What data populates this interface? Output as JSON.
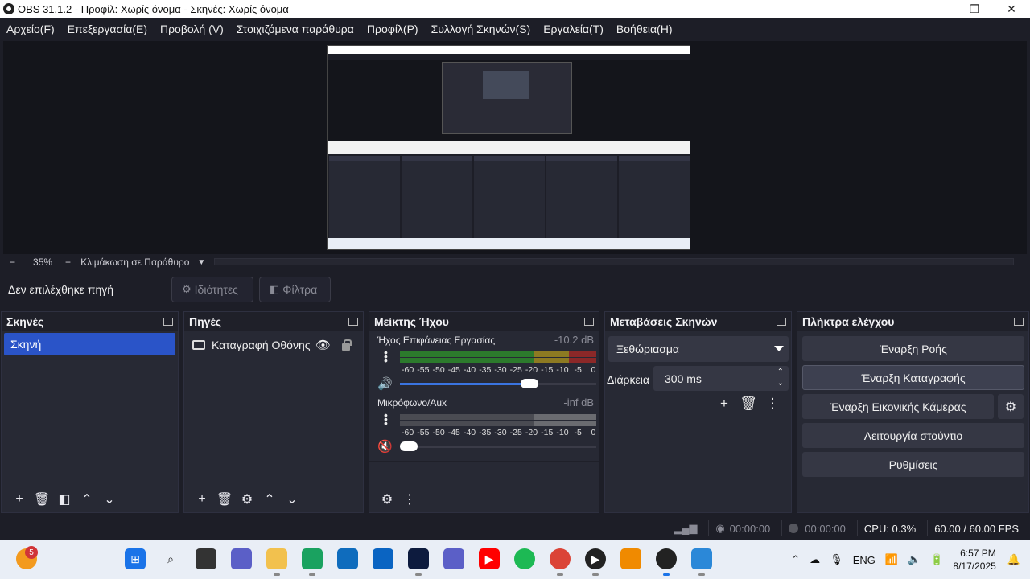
{
  "window": {
    "title": "OBS 31.1.2 - Προφίλ: Χωρίς όνομα - Σκηνές: Χωρίς όνομα",
    "minimize": "—",
    "maximize": "❐",
    "close": "✕"
  },
  "menu": [
    "Αρχείο(F)",
    "Επεξεργασία(E)",
    "Προβολή (V)",
    "Στοιχιζόμενα παράθυρα",
    "Προφίλ(P)",
    "Συλλογή Σκηνών(S)",
    "Εργαλεία(T)",
    "Βοήθεια(H)"
  ],
  "zoom": {
    "minus": "−",
    "value": "35%",
    "plus": "+",
    "mode": "Κλιμάκωση σε Παράθυρο"
  },
  "source_toolbar": {
    "no_source": "Δεν επιλέχθηκε πηγή",
    "properties": "Ιδιότητες",
    "filters": "Φίλτρα"
  },
  "scenes": {
    "title": "Σκηνές",
    "items": [
      "Σκηνή"
    ]
  },
  "sources": {
    "title": "Πηγές",
    "items": [
      "Καταγραφή Οθόνης"
    ]
  },
  "mixer": {
    "title": "Μείκτης Ήχου",
    "channels": [
      {
        "name": "Ήχος Επιφάνειας Εργασίας",
        "db": "-10.2 dB",
        "volume": 0.66,
        "muted": false
      },
      {
        "name": "Μικρόφωνο/Aux",
        "db": "-inf dB",
        "volume": 0.0,
        "muted": true
      }
    ],
    "ticks": [
      "-60",
      "-55",
      "-50",
      "-45",
      "-40",
      "-35",
      "-30",
      "-25",
      "-20",
      "-15",
      "-10",
      "-5",
      "0"
    ]
  },
  "transitions": {
    "title": "Μεταβάσεις Σκηνών",
    "selected": "Ξεθώριασμα",
    "duration_label": "Διάρκεια",
    "duration_value": "300 ms"
  },
  "controls": {
    "title": "Πλήκτρα ελέγχου",
    "start_stream": "Έναρξη Ροής",
    "start_recording": "Έναρξη Καταγραφής",
    "start_virtualcam": "Έναρξη Εικονικής Κάμερας",
    "studio_mode": "Λειτουργία στούντιο",
    "settings": "Ρυθμίσεις"
  },
  "status": {
    "stream_time": "00:00:00",
    "record_time": "00:00:00",
    "cpu": "CPU: 0.3%",
    "fps": "60.00 / 60.00 FPS"
  },
  "taskbar": {
    "badge": "5",
    "lang": "ENG",
    "time": "6:57 PM",
    "date": "8/17/2025"
  },
  "colors": {
    "accent": "#2a54c8",
    "background": "#1d1e27",
    "dock": "#272934"
  }
}
